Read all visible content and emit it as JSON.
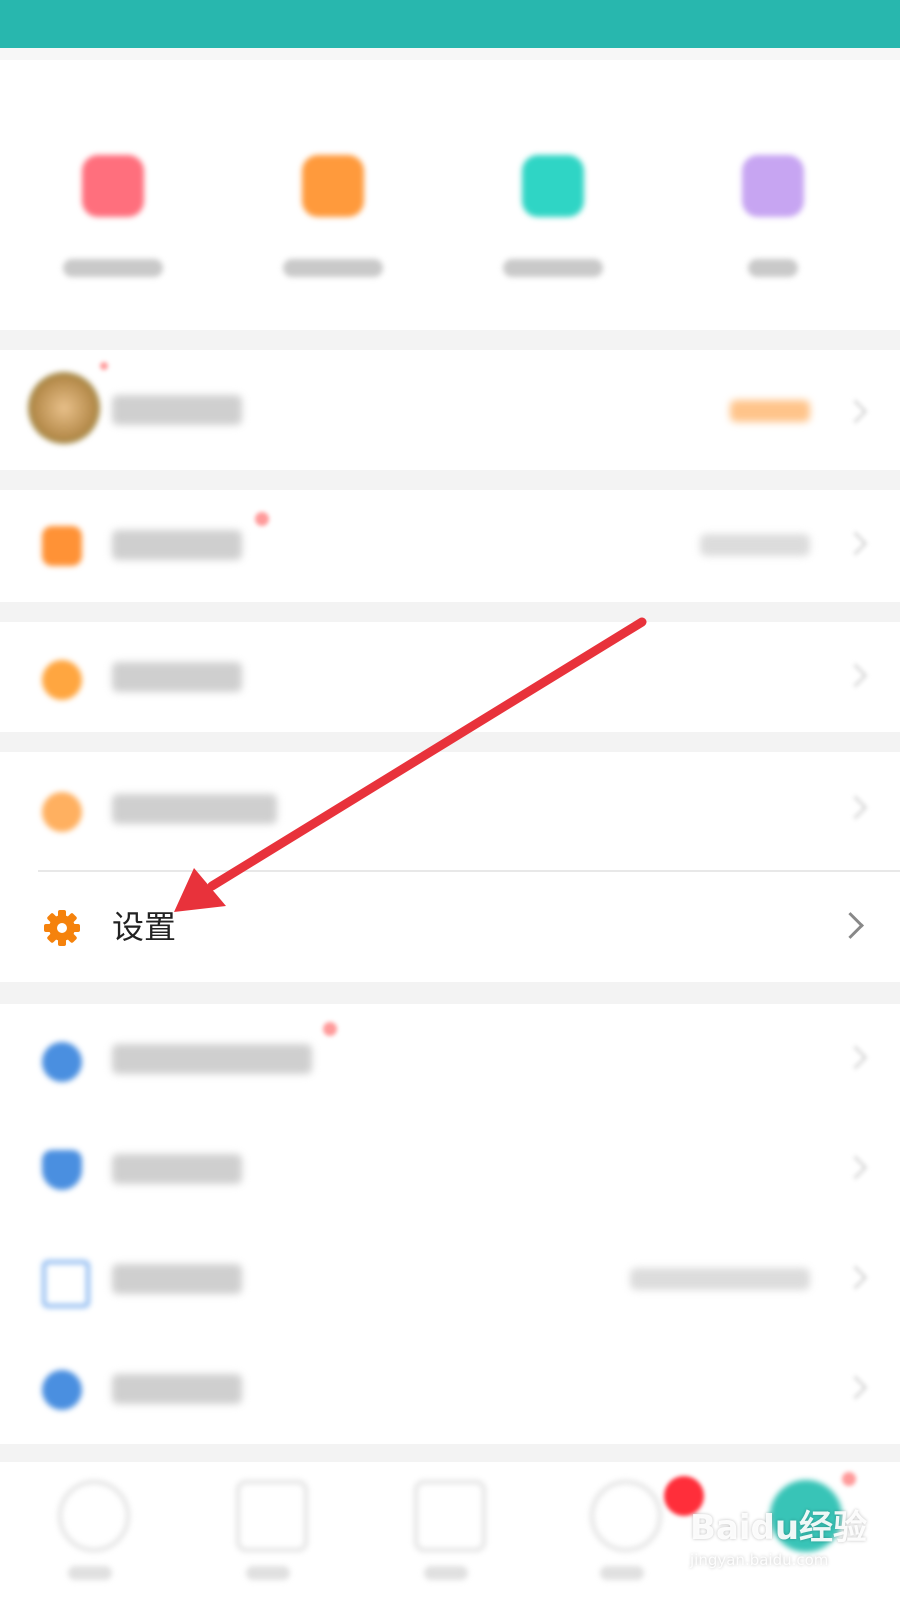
{
  "colors": {
    "header_teal": "#28b7ae",
    "accent_orange": "#f5820c",
    "arrow_red": "#e8323b",
    "icon_blue": "#4a8fe0"
  },
  "settings_item": {
    "label": "设置",
    "icon": "gear-icon"
  },
  "watermark": {
    "main": "Baidu经验",
    "sub": "jingyan.baidu.com"
  }
}
